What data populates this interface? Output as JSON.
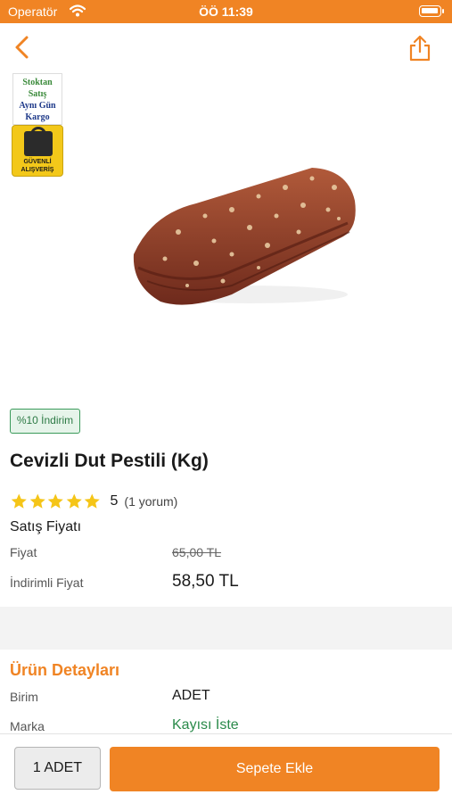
{
  "status_bar": {
    "carrier": "Operatör",
    "time": "ÖÖ 11:39",
    "battery_level": 0.9
  },
  "badges": {
    "stock": [
      "Stoktan",
      "Satış",
      "Aynı Gün",
      "Kargo"
    ],
    "secure": [
      "GÜVENLİ",
      "ALIŞVERİŞ"
    ]
  },
  "product": {
    "discount_tag": "%10 İndirim",
    "title": "Cevizli Dut Pestili (Kg)",
    "rating": {
      "stars": 5,
      "score": "5",
      "count_text": "(1 yorum)"
    },
    "price_heading": "Satış Fiyatı",
    "price_label": "Fiyat",
    "price_old": "65,00 TL",
    "discounted_label": "İndirimli Fiyat",
    "price_new": "58,50 TL"
  },
  "details": {
    "heading": "Ürün Detayları",
    "unit_label": "Birim",
    "unit_value": "ADET",
    "brand_label": "Marka",
    "brand_value": "Kayısı İste"
  },
  "bottom_bar": {
    "quantity_label": "1 ADET",
    "add_to_cart_label": "Sepete Ekle"
  },
  "colors": {
    "accent": "#f08424",
    "discount_green": "#2d7a45",
    "star": "#f5c518",
    "brand_link": "#2a8a4a"
  },
  "icons": [
    "back-arrow-icon",
    "share-icon",
    "wifi-icon",
    "battery-icon",
    "star-icon"
  ]
}
